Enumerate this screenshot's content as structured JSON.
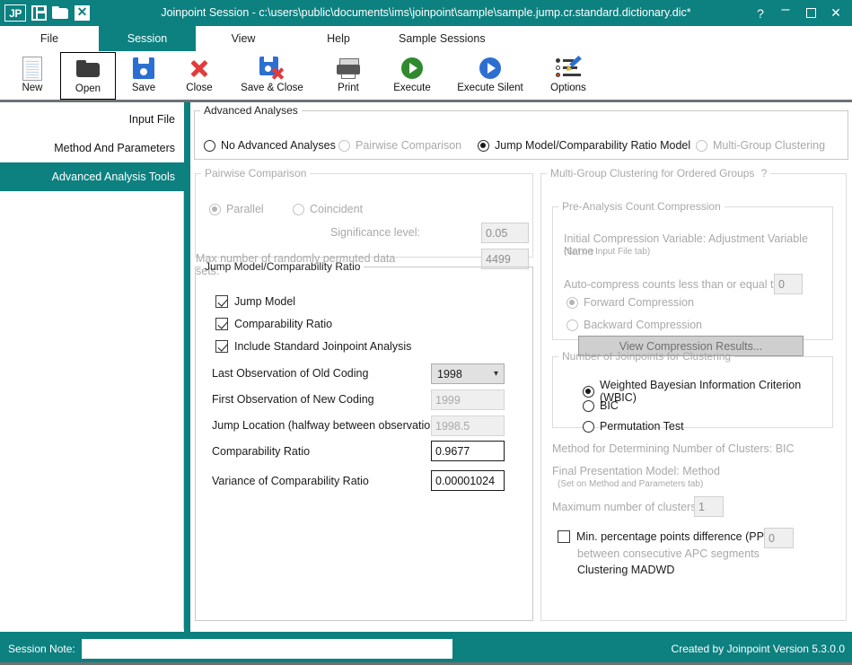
{
  "titlebar": {
    "title": "Joinpoint Session - c:\\users\\public\\documents\\ims\\joinpoint\\sample\\sample.jump.cr.standard.dictionary.dic*",
    "icons": [
      "jp-logo",
      "save-icon",
      "open-folder-icon",
      "close-document-icon"
    ],
    "help_glyph": "?",
    "minimize_glyph": "–",
    "maximize_glyph": "",
    "close_glyph": "✕",
    "bg_color": "#0d8080"
  },
  "menubar": {
    "items": [
      {
        "label": "File",
        "active": false
      },
      {
        "label": "Session",
        "active": true
      },
      {
        "label": "View",
        "active": false
      },
      {
        "label": "Help",
        "active": false
      },
      {
        "label": "Sample Sessions",
        "active": false
      }
    ]
  },
  "toolbar": {
    "buttons": [
      {
        "label": "New",
        "icon": "new-document-icon",
        "selected": false
      },
      {
        "label": "Open",
        "icon": "open-folder-icon",
        "selected": true
      },
      {
        "label": "Save",
        "icon": "save-floppy-icon",
        "selected": false
      },
      {
        "label": "Close",
        "icon": "close-x-icon",
        "selected": false
      },
      {
        "label": "Save & Close",
        "icon": "save-and-close-icon",
        "selected": false
      },
      {
        "label": "Print",
        "icon": "printer-icon",
        "selected": false
      },
      {
        "label": "Execute",
        "icon": "play-green-icon",
        "selected": false
      },
      {
        "label": "Execute Silent",
        "icon": "play-blue-icon",
        "selected": false
      },
      {
        "label": "Options",
        "icon": "options-pencil-icon",
        "selected": false
      }
    ]
  },
  "sidebar": {
    "items": [
      {
        "label": "Input File",
        "active": false
      },
      {
        "label": "Method And Parameters",
        "active": false
      },
      {
        "label": "Advanced Analysis Tools",
        "active": true
      }
    ]
  },
  "advanced_analyses": {
    "legend": "Advanced Analyses",
    "options": [
      {
        "label": "No Advanced Analyses",
        "selected": false,
        "disabled": false
      },
      {
        "label": "Pairwise Comparison",
        "selected": false,
        "disabled": true
      },
      {
        "label": "Jump Model/Comparability Ratio Model",
        "selected": true,
        "disabled": false
      },
      {
        "label": "Multi-Group Clustering",
        "selected": false,
        "disabled": true
      }
    ]
  },
  "pairwise": {
    "legend": "Pairwise Comparison",
    "parallel_label": "Parallel",
    "parallel_selected": true,
    "coincident_label": "Coincident",
    "coincident_selected": false,
    "significance_label": "Significance level:",
    "significance_value": "0.05",
    "maxperm_label": "Max number of randomly permuted data sets:",
    "maxperm_value": "4499",
    "disabled": true
  },
  "jump_model": {
    "legend": "Jump Model/Comparability Ratio",
    "checkboxes": [
      {
        "label": "Jump Model",
        "checked": true
      },
      {
        "label": "Comparability Ratio",
        "checked": true
      },
      {
        "label": "Include Standard Joinpoint Analysis",
        "checked": true
      }
    ],
    "rows": [
      {
        "label": "Last Observation of Old Coding",
        "value": "1998",
        "type": "combo",
        "disabled": false
      },
      {
        "label": "First Observation of New Coding",
        "value": "1999",
        "type": "text",
        "disabled": true
      },
      {
        "label": "Jump Location (halfway between observations)",
        "value": "1998.5",
        "type": "text",
        "disabled": true
      },
      {
        "label": "Comparability Ratio",
        "value": "0.9677",
        "type": "text",
        "disabled": false
      },
      {
        "label": "Variance of Comparability Ratio",
        "value": "0.00001024",
        "type": "text",
        "disabled": false
      }
    ],
    "chevron": "⌄"
  },
  "clustering": {
    "legend": "Multi-Group Clustering for Ordered Groups",
    "help_glyph": "?",
    "compression": {
      "legend": "Pre-Analysis Count Compression",
      "initial_variable_label": "Initial Compression Variable:  Adjustment Variable Name",
      "initial_variable_note": "(Set on Input File tab)",
      "autocompress_label": "Auto-compress counts less than or equal to:",
      "autocompress_value": "0",
      "forward_label": "Forward Compression",
      "forward_selected": true,
      "backward_label": "Backward Compression",
      "backward_selected": false,
      "view_results_button": "View Compression Results..."
    },
    "joinpoints": {
      "legend": "Number of Joinpoints for Clustering",
      "options": [
        {
          "label": "Weighted Bayesian Information Criterion (WBIC)",
          "selected": true
        },
        {
          "label": "BIC",
          "selected": false
        },
        {
          "label": "Permutation Test",
          "selected": false
        }
      ]
    },
    "method_clusters_label": "Method for Determining Number of Clusters: BIC",
    "final_model_label": "Final Presentation Model: Method",
    "final_model_note": "(Set on Method and Parameters tab)",
    "max_clusters_label": "Maximum number of clusters:",
    "max_clusters_value": "1",
    "ppd_label": "Min. percentage points difference (PPD)",
    "ppd_sublabel": "between consecutive APC segments",
    "ppd_checked": false,
    "ppd_value": "0",
    "madwd_label": "Clustering MADWD"
  },
  "statusbar": {
    "session_note_label": "Session Note:",
    "session_note_value": "",
    "session_note_placeholder": "",
    "version_text": "Created by Joinpoint Version 5.3.0.0"
  }
}
